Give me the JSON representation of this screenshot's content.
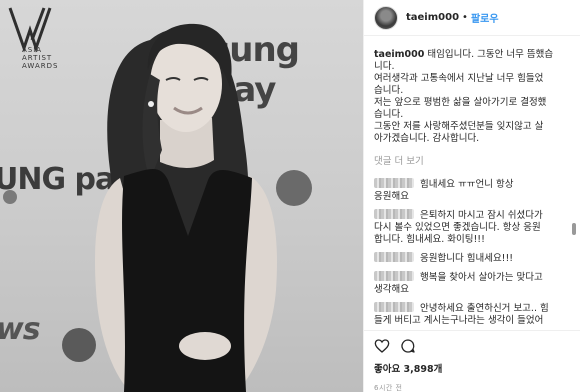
{
  "photo": {
    "bg_pay_top": "sung pay",
    "bg_pay_left": "UNG pay",
    "bg_news": "ws",
    "logo_text": [
      "ASIA",
      "ARTIST",
      "AWARDS"
    ]
  },
  "post": {
    "username": "taeim000",
    "dot": "•",
    "follow_label": "팔로우",
    "caption_user": "taeim000",
    "caption_lines": [
      "태임입니다. 그동안 너무 뜸했습",
      "니다.",
      "여러생각과 고통속에서 지난날 너무 힘들었",
      "습니다.",
      "저는 앞으로 평범한 삶을 살아가기로 결정했",
      "습니다.",
      "그동안 저를 사랑해주셨던분들 잊지않고 살",
      "아가겠습니다. 감사합니다."
    ],
    "more_comments": "댓글 더 보기",
    "comments": [
      {
        "first": "힘내세요 ㅠㅠ언니 항상",
        "rest": [
          "응원해요"
        ]
      },
      {
        "first": "은퇴하지 마시고 잠시 쉬셨다가",
        "rest": [
          "다시 볼수 있었으면 좋겠습니다. 항상 응원",
          "합니다. 힘내세요. 화이팅!!!"
        ]
      },
      {
        "first": "응원합니다 힘내세요!!!",
        "rest": []
      },
      {
        "first": "행복을 찾아서 살아가는 맞다고",
        "rest": [
          "생각해요"
        ]
      },
      {
        "first": "안녕하세요 출연하신거 보고.. 힘",
        "rest": [
          "들게 버티고 계시는구나라는 생각이 들었어"
        ]
      }
    ],
    "likes": "좋아요 3,898개",
    "time": "6시간 전"
  }
}
